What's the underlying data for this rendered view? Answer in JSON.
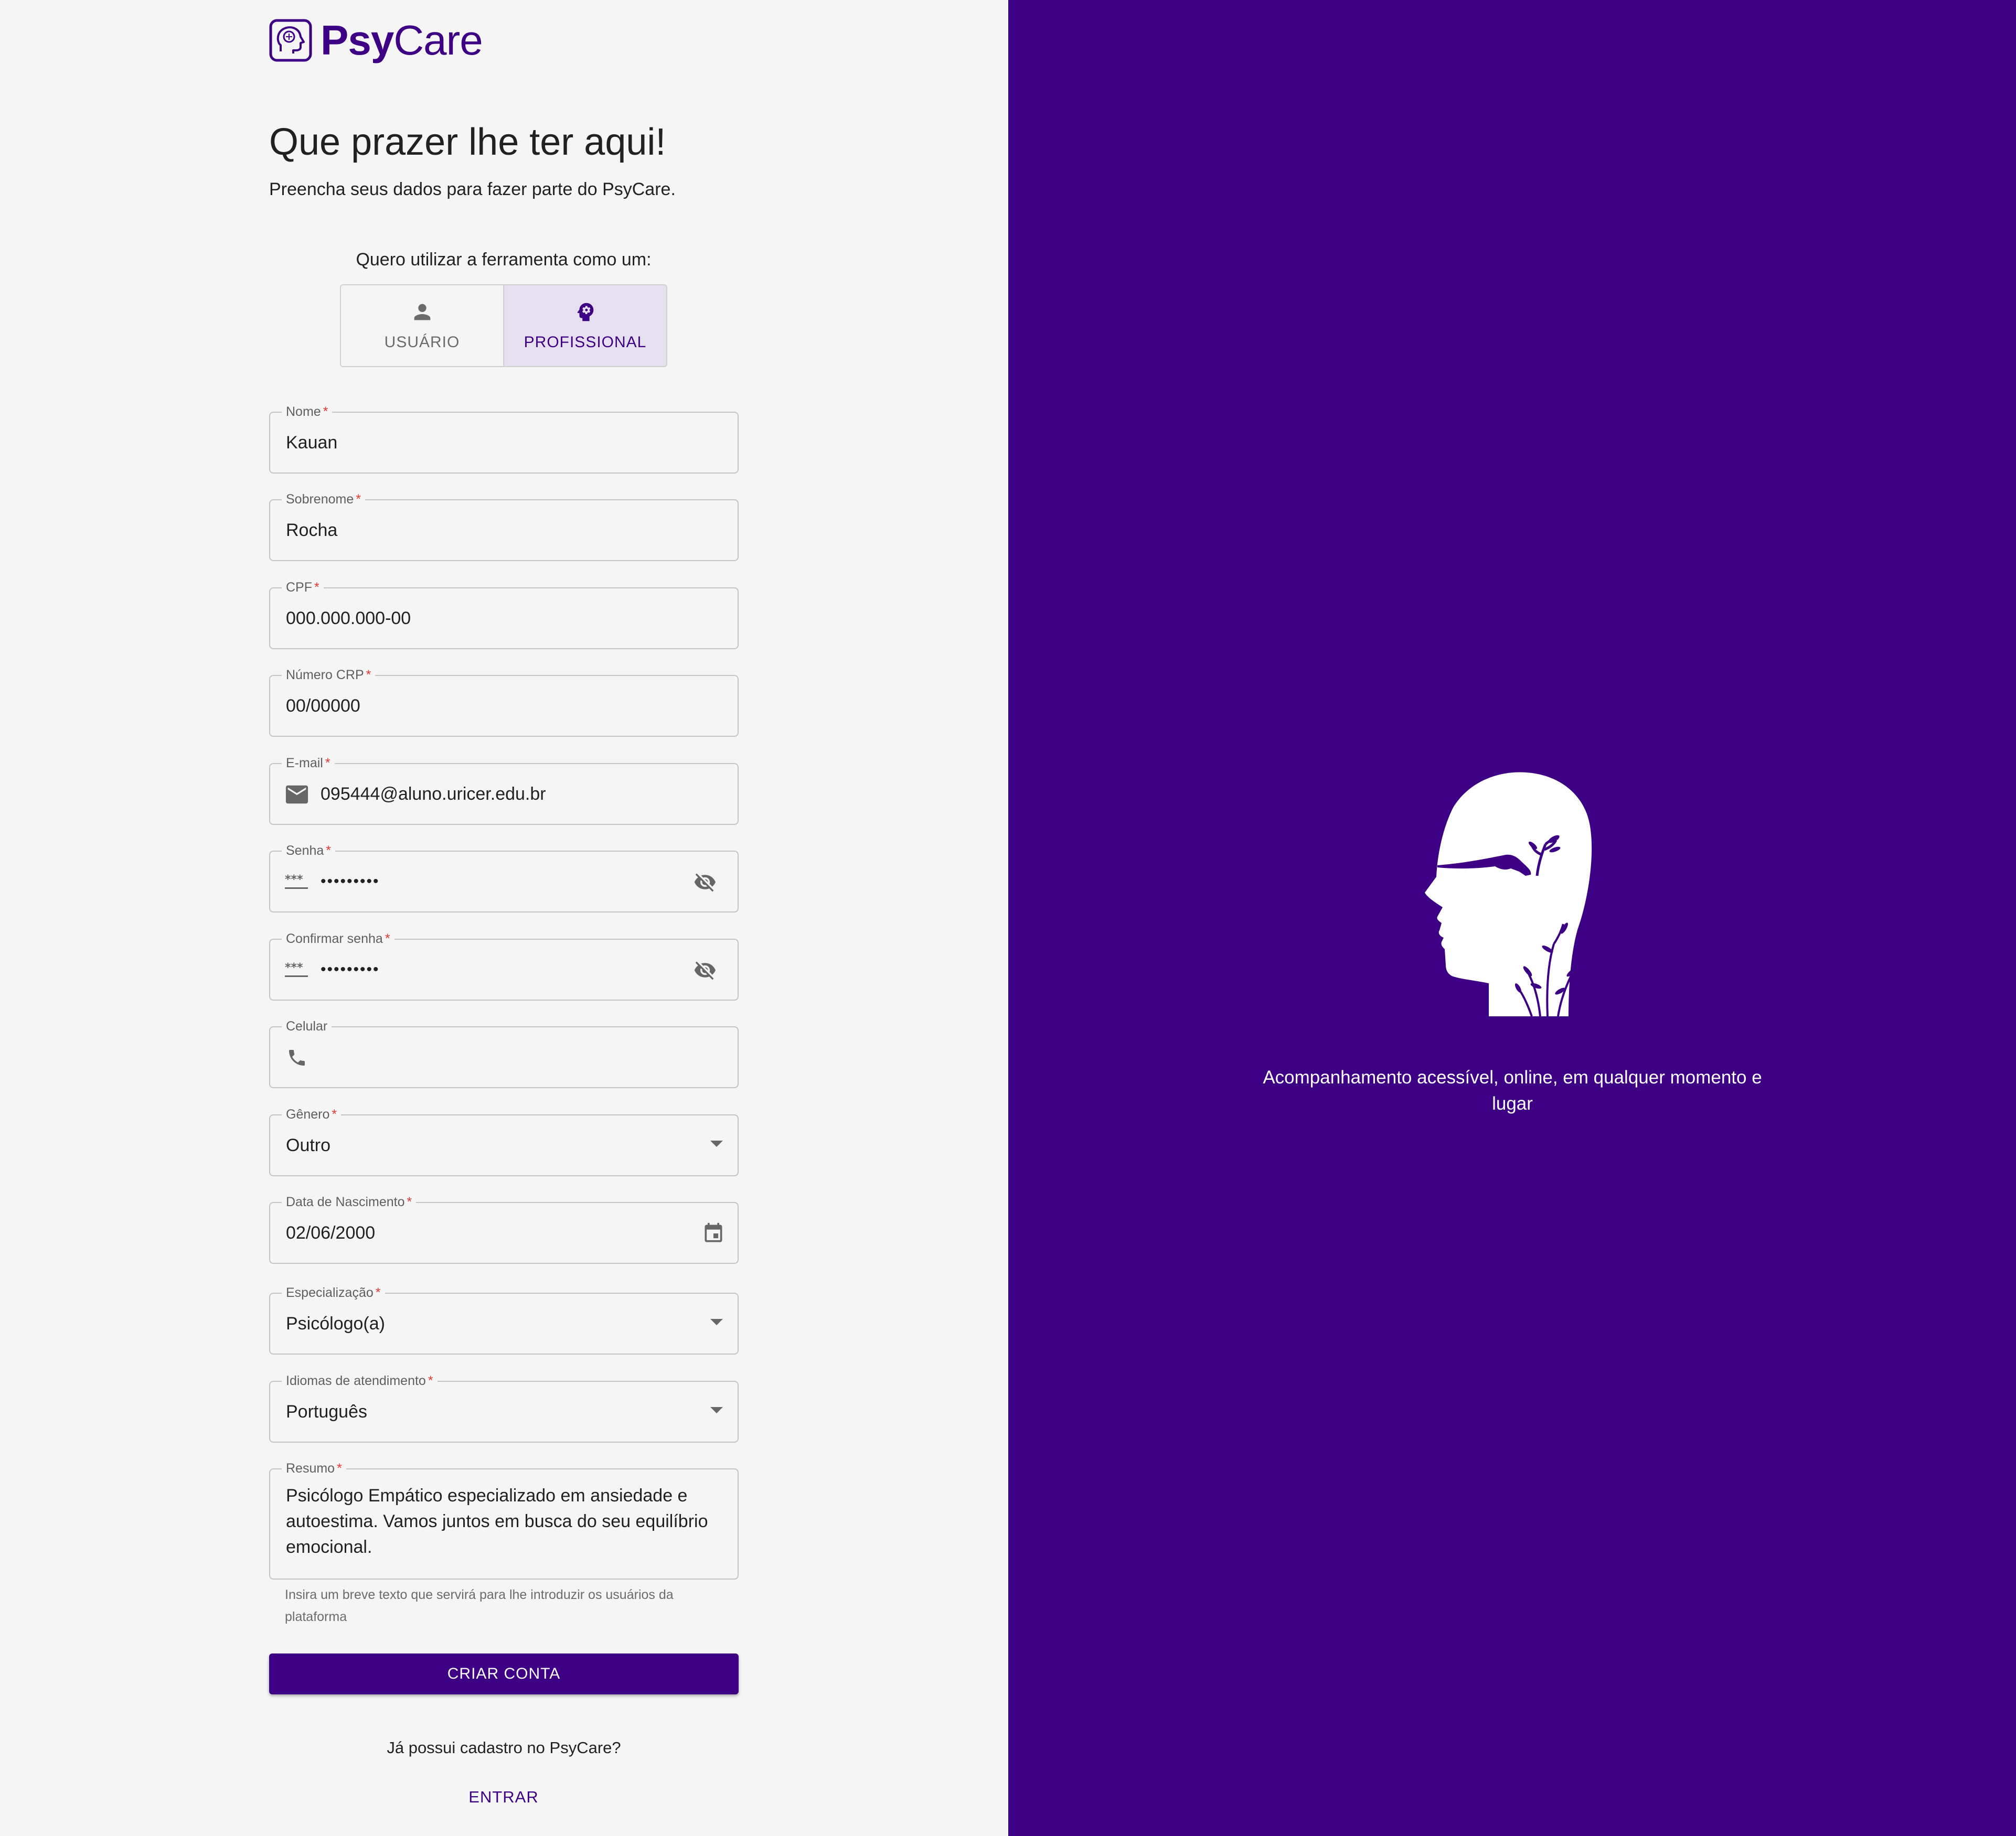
{
  "brand": {
    "name_bold": "Psy",
    "name_regular": "Care"
  },
  "heading": "Que prazer lhe ter aqui!",
  "subheading": "Preencha seus dados para fazer parte do PsyCare.",
  "role_selector": {
    "label": "Quero utilizar a ferramenta como um:",
    "options": [
      {
        "label": "USUÁRIO",
        "icon": "person-icon",
        "selected": false
      },
      {
        "label": "PROFISSIONAL",
        "icon": "psychology-icon",
        "selected": true
      }
    ]
  },
  "form": {
    "nome": {
      "label": "Nome",
      "required": "*",
      "value": "Kauan"
    },
    "sobrenome": {
      "label": "Sobrenome",
      "required": "*",
      "value": "Rocha"
    },
    "cpf": {
      "label": "CPF",
      "required": "*",
      "value": "000.000.000-00"
    },
    "crp": {
      "label": "Número CRP",
      "required": "*",
      "value": "00/00000"
    },
    "email": {
      "label": "E-mail",
      "required": "*",
      "value": "095444@aluno.uricer.edu.br",
      "icon": "mail-icon"
    },
    "senha": {
      "label": "Senha",
      "required": "*",
      "value": "•••••••••",
      "icon": "password-icon",
      "toggle_icon": "visibility-off-icon"
    },
    "confirmar_senha": {
      "label": "Confirmar senha",
      "required": "*",
      "value": "•••••••••",
      "icon": "password-icon",
      "toggle_icon": "visibility-off-icon"
    },
    "celular": {
      "label": "Celular",
      "value": "",
      "icon": "phone-icon"
    },
    "genero": {
      "label": "Gênero",
      "required": "*",
      "value": "Outro"
    },
    "nascimento": {
      "label": "Data de Nascimento",
      "required": "*",
      "value": "02/06/2000",
      "icon": "calendar-icon"
    },
    "especializacao": {
      "label": "Especialização",
      "required": "*",
      "value": "Psicólogo(a)"
    },
    "idiomas": {
      "label": "Idiomas de atendimento",
      "required": "*",
      "value": "Português"
    },
    "resumo": {
      "label": "Resumo",
      "required": "*",
      "value": "Psicólogo Empático especializado em ansiedade e\nautoestima. Vamos juntos em busca do seu equilíbrio\nemocional.",
      "hint": "Insira um breve texto que servirá para lhe introduzir os usuários da plataforma"
    }
  },
  "submit_label": "CRIAR CONTA",
  "login_prompt": "Já possui cadastro no PsyCare?",
  "login_label": "ENTRAR",
  "side_panel": {
    "tagline": "Acompanhamento acessível, online, em qualquer momento e lugar",
    "illustration": "head-with-plants-illustration"
  },
  "colors": {
    "brand": "#3d0085",
    "background": "#f5f5f5",
    "selected_toggle": "#e6dff0",
    "required": "#e53935"
  }
}
